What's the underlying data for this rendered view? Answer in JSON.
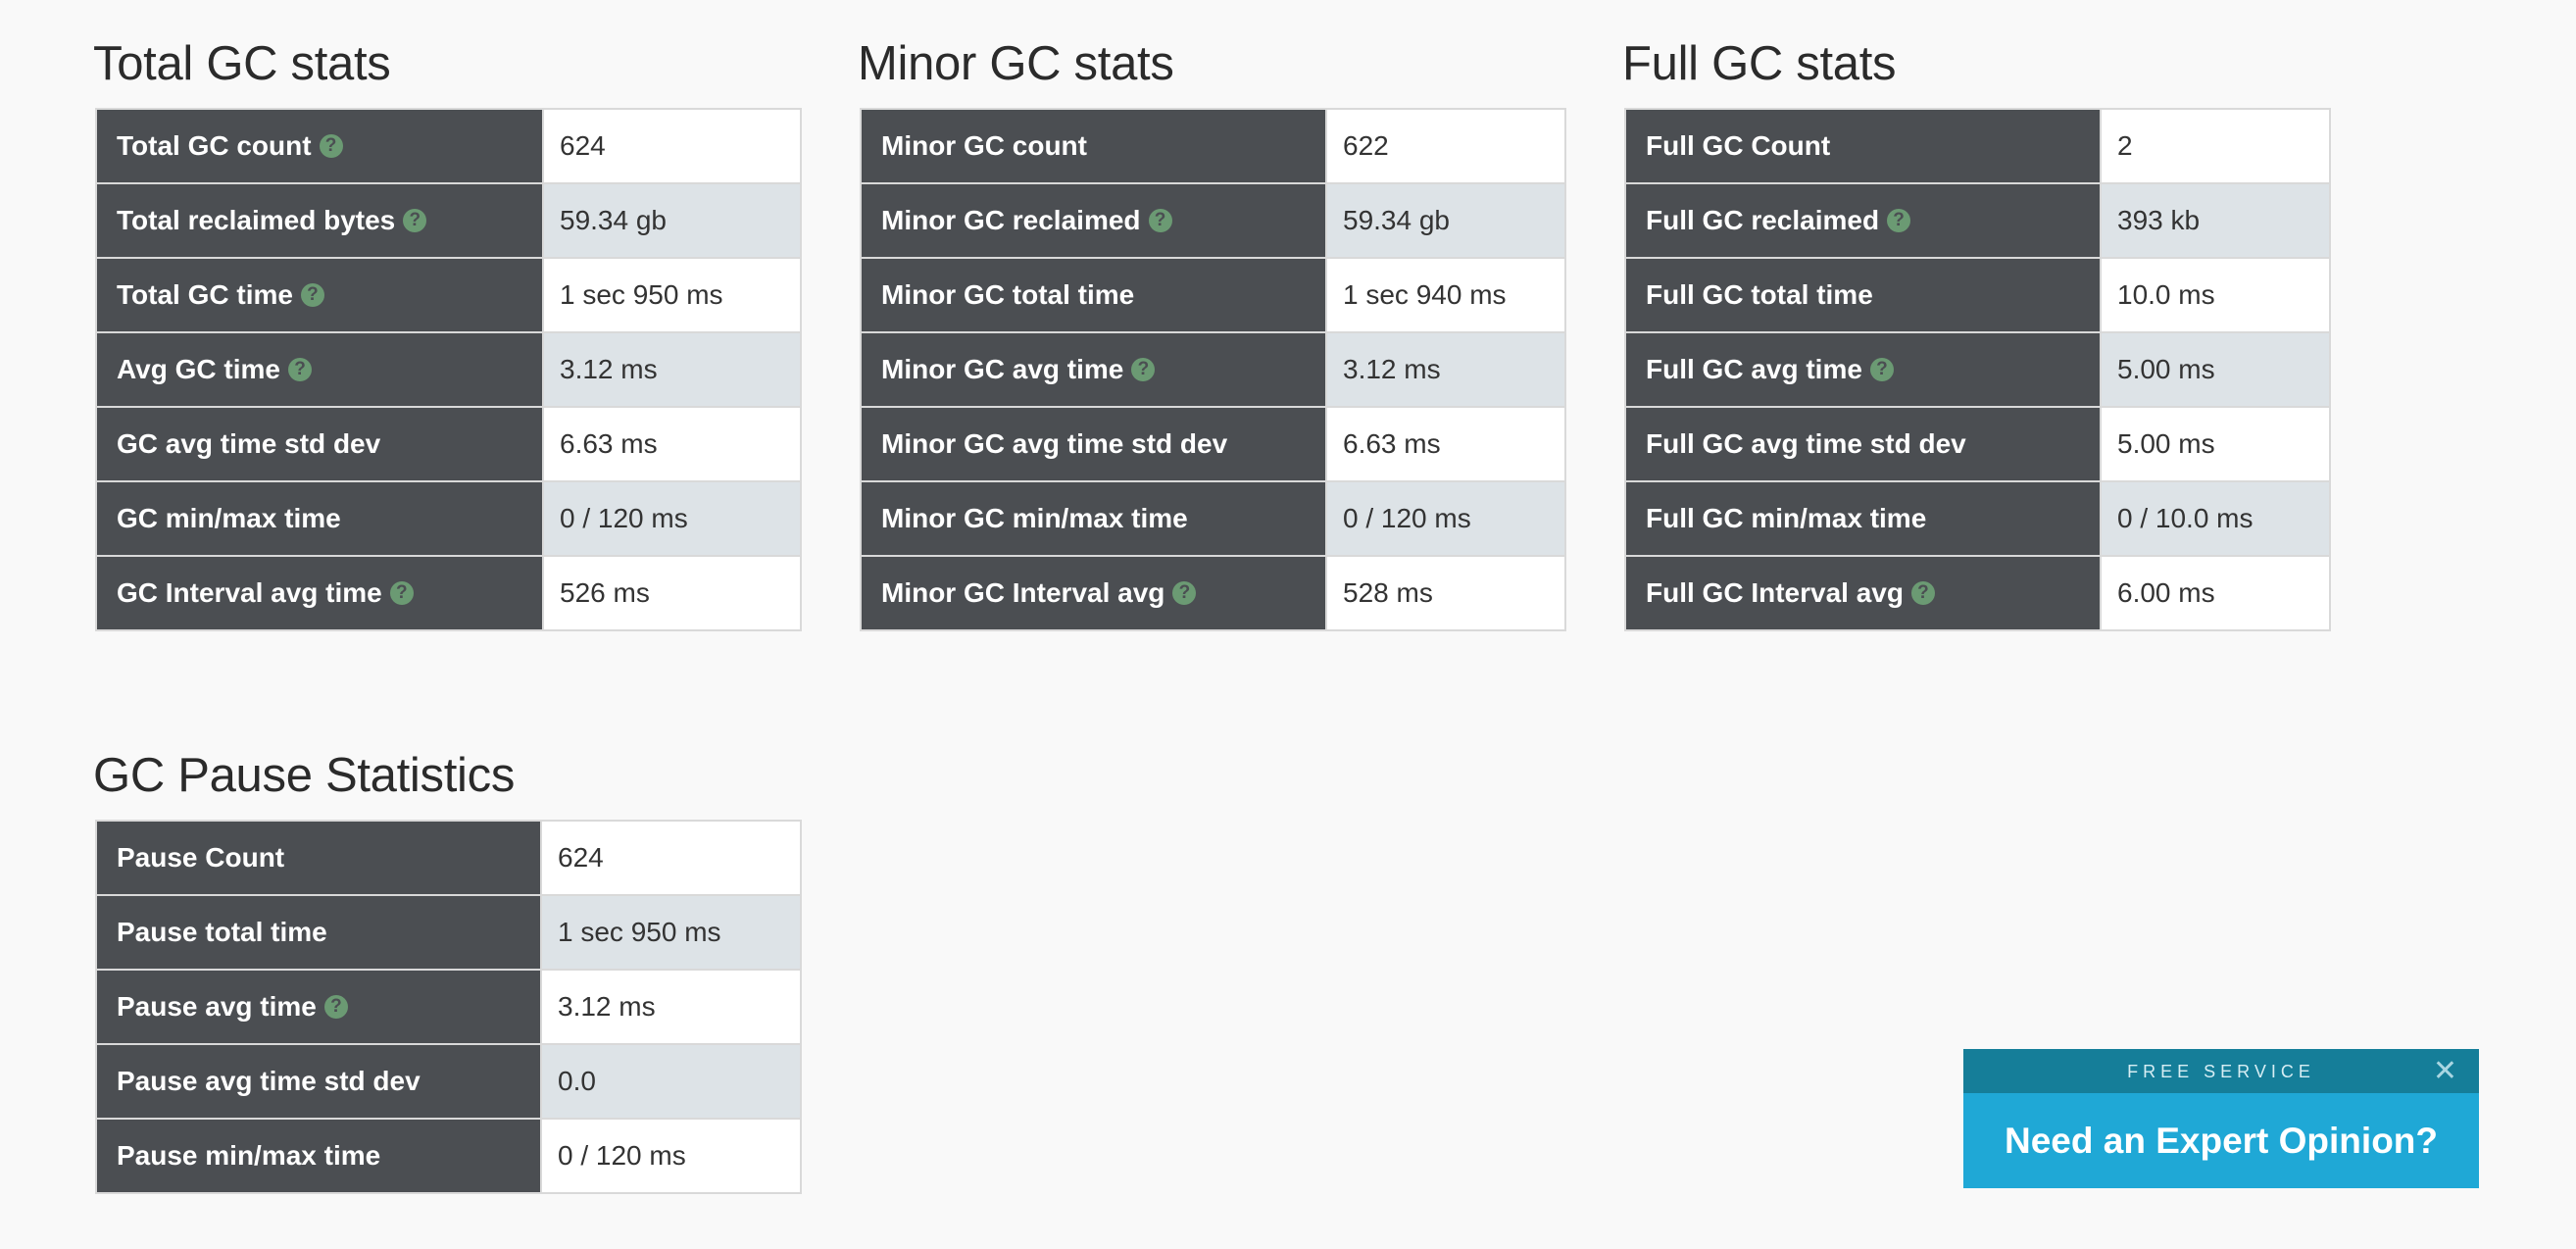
{
  "total": {
    "title": "Total GC stats",
    "rows": [
      {
        "label": "Total GC count",
        "value": "624",
        "help": true
      },
      {
        "label": "Total reclaimed bytes",
        "value": "59.34 gb",
        "help": true
      },
      {
        "label": "Total GC time",
        "value": "1 sec 950 ms",
        "help": true
      },
      {
        "label": "Avg GC time",
        "value": "3.12 ms",
        "help": true
      },
      {
        "label": "GC avg time std dev",
        "value": "6.63 ms",
        "help": false
      },
      {
        "label": "GC min/max time",
        "value": "0 / 120 ms",
        "help": false
      },
      {
        "label": "GC Interval avg time",
        "value": "526 ms",
        "help": true
      }
    ]
  },
  "minor": {
    "title": "Minor GC stats",
    "rows": [
      {
        "label": "Minor GC count",
        "value": "622",
        "help": false
      },
      {
        "label": "Minor GC reclaimed",
        "value": "59.34 gb",
        "help": true
      },
      {
        "label": "Minor GC total time",
        "value": "1 sec 940 ms",
        "help": false
      },
      {
        "label": "Minor GC avg time",
        "value": "3.12 ms",
        "help": true
      },
      {
        "label": "Minor GC avg time std dev",
        "value": "6.63 ms",
        "help": false
      },
      {
        "label": "Minor GC min/max time",
        "value": "0 / 120 ms",
        "help": false
      },
      {
        "label": "Minor GC Interval avg",
        "value": "528 ms",
        "help": true
      }
    ]
  },
  "full": {
    "title": "Full GC stats",
    "rows": [
      {
        "label": "Full GC Count",
        "value": "2",
        "help": false
      },
      {
        "label": "Full GC reclaimed",
        "value": "393 kb",
        "help": true
      },
      {
        "label": "Full GC total time",
        "value": "10.0 ms",
        "help": false
      },
      {
        "label": "Full GC avg time",
        "value": "5.00 ms",
        "help": true
      },
      {
        "label": "Full GC avg time std dev",
        "value": "5.00 ms",
        "help": false
      },
      {
        "label": "Full GC min/max time",
        "value": "0 / 10.0 ms",
        "help": false
      },
      {
        "label": "Full GC Interval avg",
        "value": "6.00 ms",
        "help": true
      }
    ]
  },
  "pause": {
    "title": "GC Pause Statistics",
    "rows": [
      {
        "label": "Pause Count",
        "value": "624",
        "help": false
      },
      {
        "label": "Pause total time",
        "value": "1 sec 950 ms",
        "help": false
      },
      {
        "label": "Pause avg time",
        "value": "3.12 ms",
        "help": true
      },
      {
        "label": "Pause avg time std dev",
        "value": "0.0",
        "help": false
      },
      {
        "label": "Pause min/max time",
        "value": "0 / 120 ms",
        "help": false
      }
    ]
  },
  "help_icon_glyph": "?",
  "colors": {
    "label_bg": "#4b4e52",
    "row_alt_bg": "#dde3e7",
    "help_icon": "#6b9a73",
    "promo_top": "#157e99",
    "promo_main": "#1fa8d6"
  },
  "promo": {
    "tagline": "FREE SERVICE",
    "close_glyph": "✕",
    "headline": "Need an Expert Opinion?"
  }
}
